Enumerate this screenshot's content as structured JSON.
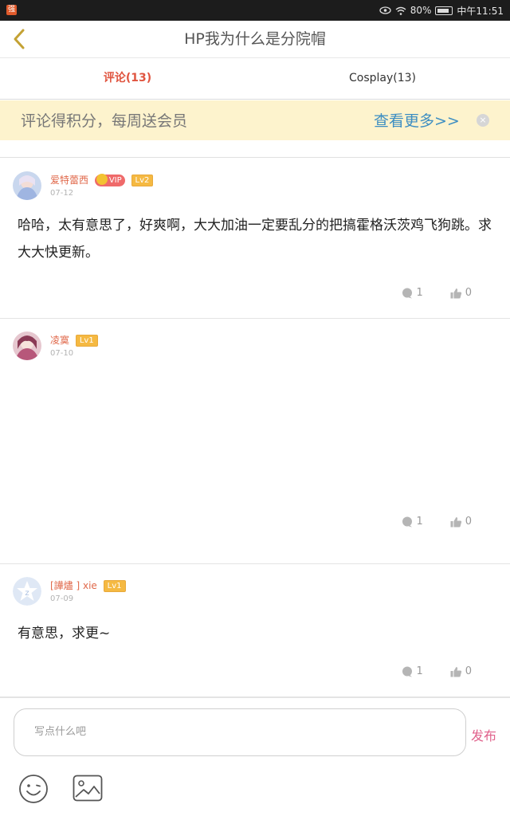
{
  "status_bar": {
    "app_badge": "强",
    "battery_percent": "80%",
    "time": "中午11:51"
  },
  "header": {
    "title": "HP我为什么是分院帽",
    "back_icon": "chevron-left-icon"
  },
  "tabs": [
    {
      "label": "评论(13)",
      "active": true
    },
    {
      "label": "Cosplay(13)",
      "active": false
    }
  ],
  "promo": {
    "text": "评论得积分，每周送会员",
    "more_link": "查看更多>>",
    "close_icon": "×"
  },
  "comments": [
    {
      "username": "爱特蕾西",
      "vip_label": "VIP",
      "level": "Lv2",
      "date": "07-12",
      "content": "哈哈，太有意思了，好爽啊，大大加油一定要乱分的把搞霍格沃茨鸡飞狗跳。求大大快更新。",
      "reply_count": "1",
      "like_count": "0"
    },
    {
      "username": "凌寞",
      "level": "Lv1",
      "date": "07-10",
      "content": "",
      "reply_count": "1",
      "like_count": "0"
    },
    {
      "username": "[譁燼 ] xie",
      "level": "Lv1",
      "date": "07-09",
      "content": "有意思，求更~",
      "reply_count": "1",
      "like_count": "0"
    }
  ],
  "input": {
    "placeholder": "写点什么吧",
    "publish_label": "发布"
  },
  "colors": {
    "accent_tab": "#e05540",
    "promo_bg": "#fdf3cd",
    "promo_link": "#3d8ec2",
    "username": "#e0684a",
    "publish": "#e0628c",
    "level_badge": "#f5b942"
  }
}
